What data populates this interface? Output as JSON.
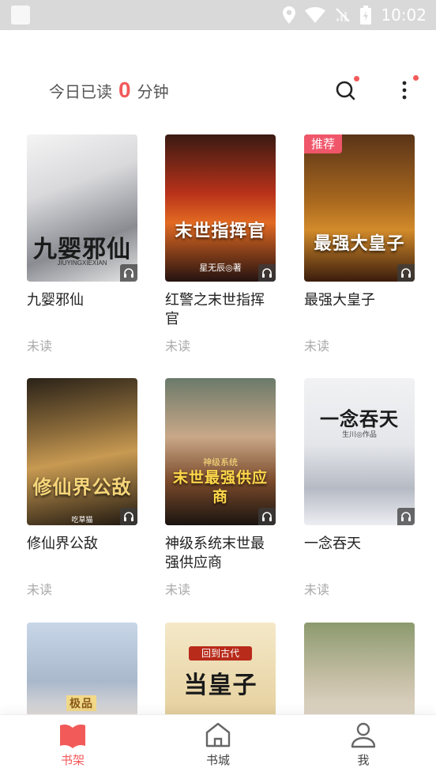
{
  "status_bar": {
    "time": "10:02"
  },
  "header": {
    "read_prefix": "今日已读",
    "read_count": "0",
    "read_suffix": "分钟"
  },
  "books": [
    {
      "title": "九婴邪仙",
      "status": "未读",
      "cover_text": "九婴邪仙",
      "cover_sub": "JIUYINGXIEXIAN",
      "badge": "",
      "audio": true
    },
    {
      "title": "红警之末世指挥官",
      "status": "未读",
      "cover_text": "末世指挥官",
      "cover_sub": "星无辰◎著",
      "badge": "",
      "audio": true
    },
    {
      "title": "最强大皇子",
      "status": "未读",
      "cover_text": "最强大皇子",
      "cover_sub": "",
      "badge": "推荐",
      "audio": true
    },
    {
      "title": "修仙界公敌",
      "status": "未读",
      "cover_text": "修仙界公敌",
      "cover_sub": "吃草猫",
      "badge": "",
      "audio": true
    },
    {
      "title": "神级系统末世最强供应商",
      "status": "未读",
      "cover_text": "末世最强供应商",
      "cover_sub": "神级系统",
      "badge": "",
      "audio": true
    },
    {
      "title": "一念吞天",
      "status": "未读",
      "cover_text": "一念吞天",
      "cover_sub": "生川◎作品",
      "badge": "",
      "audio": true
    },
    {
      "title": "",
      "status": "",
      "cover_text": "极品",
      "cover_sub": "",
      "badge": "",
      "audio": false
    },
    {
      "title": "",
      "status": "",
      "cover_text": "当皇子",
      "cover_sub": "回到古代",
      "badge": "",
      "audio": false
    },
    {
      "title": "",
      "status": "",
      "cover_text": "",
      "cover_sub": "",
      "badge": "",
      "audio": false
    }
  ],
  "bottom_nav": [
    {
      "label": "书架",
      "icon": "book-icon",
      "active": true
    },
    {
      "label": "书城",
      "icon": "home-icon",
      "active": false
    },
    {
      "label": "我",
      "icon": "user-icon",
      "active": false
    }
  ],
  "colors": {
    "accent": "#f25a5a",
    "badge": "#f0566a",
    "status_bar": "#d9d9d9"
  }
}
